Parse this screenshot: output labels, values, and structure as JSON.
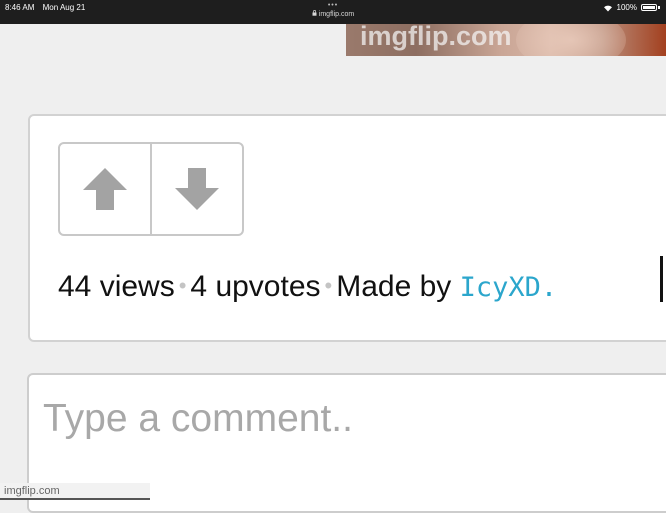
{
  "status_bar": {
    "time": "8:46 AM",
    "date": "Mon Aug 21",
    "dots": "•••",
    "url": "imgflip.com",
    "battery": "100%"
  },
  "watermarks": {
    "top": "imgflip.com",
    "bottom": "imgflip.com"
  },
  "vote_panel": {
    "upvote_icon": "arrow-up-icon",
    "downvote_icon": "arrow-down-icon"
  },
  "stats": {
    "views": "44 views",
    "separator": "•",
    "upvotes": "4 upvotes",
    "made_by": "Made by",
    "author": "IcyXD."
  },
  "comment": {
    "placeholder": "Type a comment.."
  },
  "colors": {
    "author_link": "#2ba6cc",
    "arrow": "#a3a3a3",
    "border": "#c8c8c8"
  }
}
